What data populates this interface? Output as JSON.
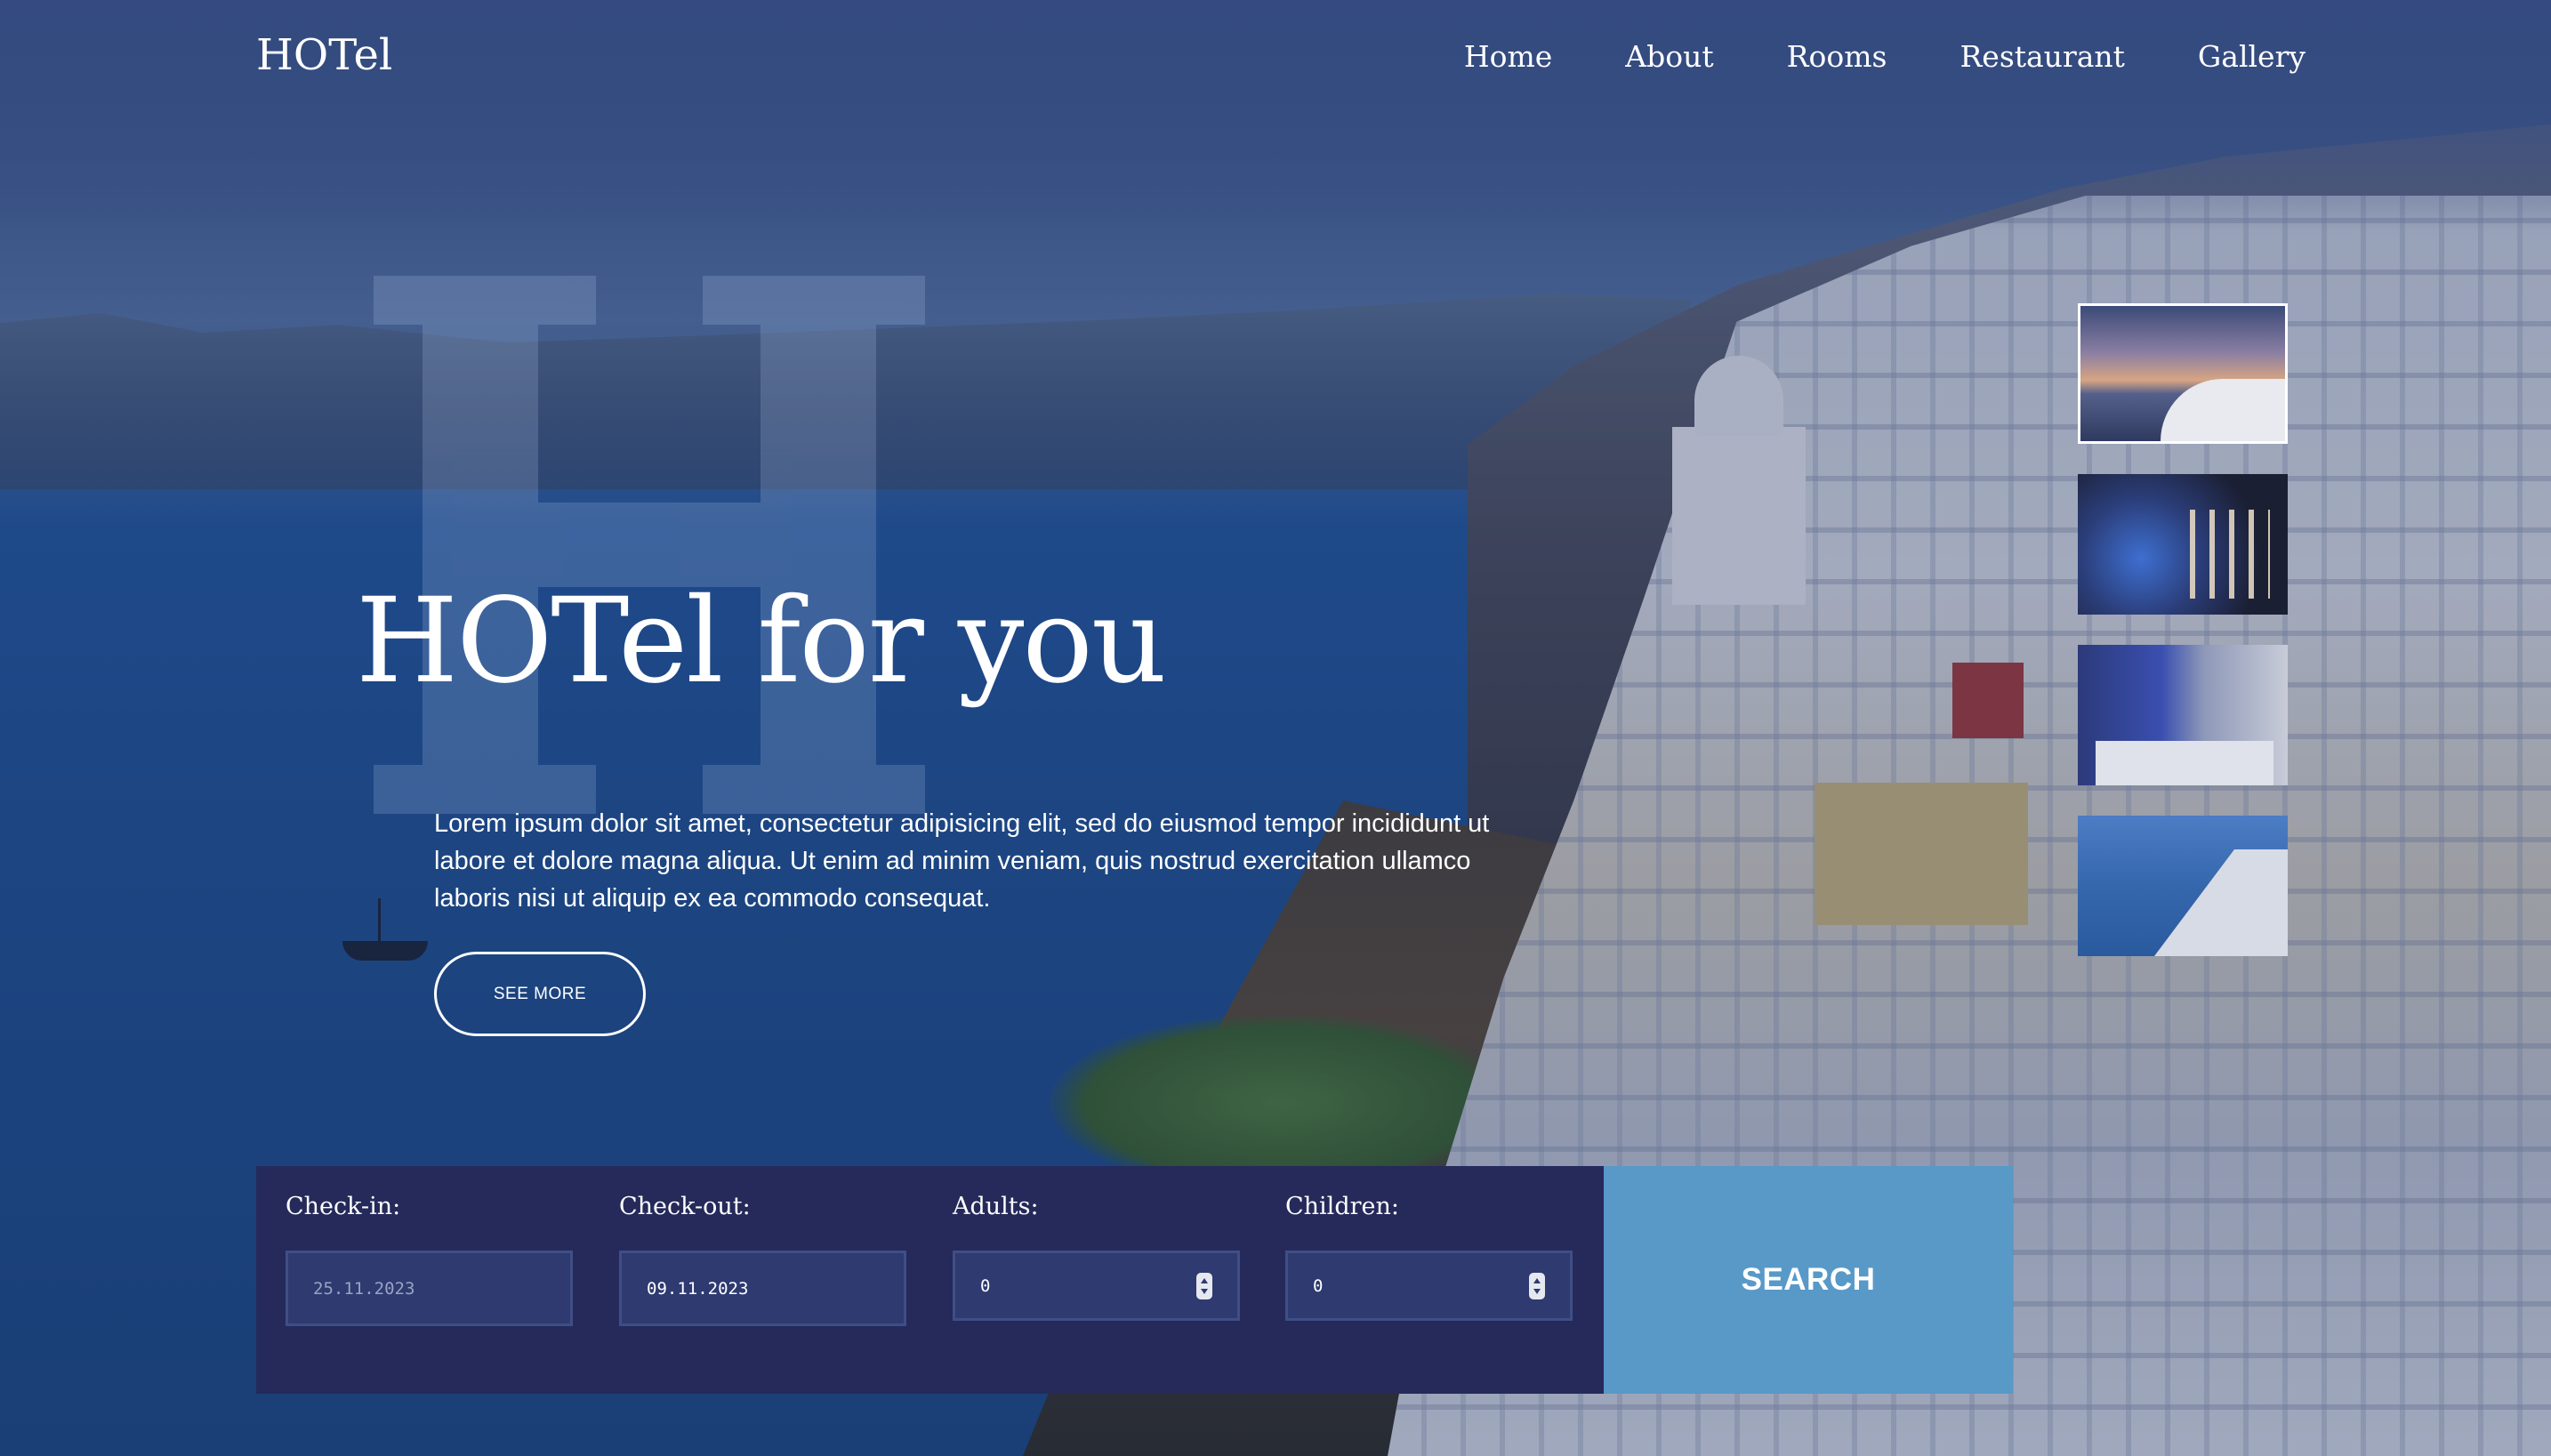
{
  "header": {
    "logo": "HOTel",
    "nav": [
      {
        "label": "Home"
      },
      {
        "label": "About"
      },
      {
        "label": "Rooms"
      },
      {
        "label": "Restaurant"
      },
      {
        "label": "Gallery"
      }
    ]
  },
  "hero": {
    "watermark_letter": "H",
    "headline": "HOTel for you",
    "lede": "Lorem ipsum dolor sit amet, consectetur adipisicing elit, sed do eiusmod tempor incididunt ut labore et dolore magna aliqua. Ut enim ad minim veniam, quis nostrud exercitation ullamco laboris nisi ut aliquip ex ea commodo consequat.",
    "cta_label": "SEE MORE"
  },
  "booking": {
    "checkin": {
      "label": "Check-in:",
      "value": "25.11.2023"
    },
    "checkout": {
      "label": "Check-out:",
      "value": "09.11.2023"
    },
    "adults": {
      "label": "Adults:",
      "value": "0"
    },
    "children": {
      "label": "Children:",
      "value": "0"
    },
    "search_label": "SEARCH"
  },
  "icons": {
    "stepper": "spinner-icon"
  },
  "colors": {
    "booking_bg": "#252a5a",
    "input_bg": "#2e3a70",
    "search_bg": "#5899c8",
    "text": "#ffffff"
  }
}
